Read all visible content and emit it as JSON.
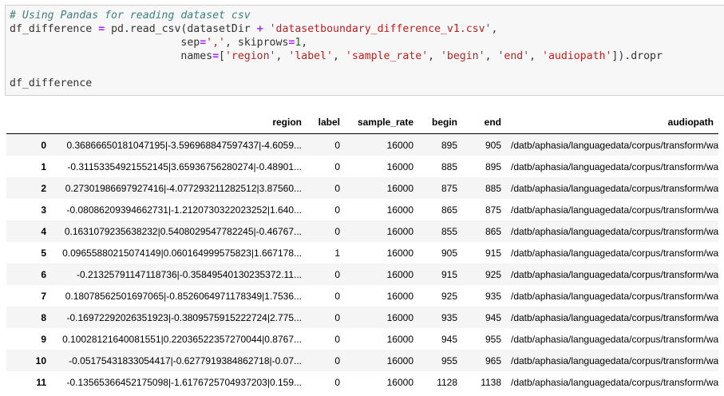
{
  "code_cell": {
    "comment": "# Using Pandas for reading dataset csv",
    "line2": {
      "var": "df_difference",
      "eq": "=",
      "call": "pd.read_csv(datasetDir",
      "plus": "+",
      "file": "'datasetboundary_difference_v1.csv'",
      "comma": ","
    },
    "line3": {
      "indent": "                           ",
      "sep_kw": "sep",
      "eq": "=",
      "sep_val": "','",
      "mid": ", skiprows",
      "eq2": "=",
      "skip_val": "1",
      "end": ","
    },
    "line4": {
      "indent": "                           ",
      "names_kw": "names",
      "eq": "=",
      "open": "[",
      "n1": "'region'",
      "n2": "'label'",
      "n3": "'sample_rate'",
      "n4": "'begin'",
      "n5": "'end'",
      "n6": "'audiopath'",
      "sep": ", ",
      "close": "]).dropr"
    },
    "line6": "df_difference"
  },
  "dataframe": {
    "columns": [
      "region",
      "label",
      "sample_rate",
      "begin",
      "end",
      "audiopath"
    ],
    "rows": [
      {
        "index": "0",
        "region": "0.36866650181047195|-3.596968847597437|-4.6059...",
        "label": "0",
        "sample_rate": "16000",
        "begin": "895",
        "end": "905",
        "audiopath": "/datb/aphasia/languagedata/corpus/transform/wa..."
      },
      {
        "index": "1",
        "region": "-0.31153354921552145|3.65936756280274|-0.48901...",
        "label": "0",
        "sample_rate": "16000",
        "begin": "885",
        "end": "895",
        "audiopath": "/datb/aphasia/languagedata/corpus/transform/wa..."
      },
      {
        "index": "2",
        "region": "0.27301986697927416|-4.077293211282512|3.87560...",
        "label": "0",
        "sample_rate": "16000",
        "begin": "875",
        "end": "885",
        "audiopath": "/datb/aphasia/languagedata/corpus/transform/wa..."
      },
      {
        "index": "3",
        "region": "-0.08086209394662731|-1.2120730322023252|1.640...",
        "label": "0",
        "sample_rate": "16000",
        "begin": "865",
        "end": "875",
        "audiopath": "/datb/aphasia/languagedata/corpus/transform/wa..."
      },
      {
        "index": "4",
        "region": "0.1631079235638232|0.5408029547782245|-0.46767...",
        "label": "0",
        "sample_rate": "16000",
        "begin": "855",
        "end": "865",
        "audiopath": "/datb/aphasia/languagedata/corpus/transform/wa..."
      },
      {
        "index": "5",
        "region": "0.09655880215074149|0.060164999575823|1.667178...",
        "label": "1",
        "sample_rate": "16000",
        "begin": "905",
        "end": "915",
        "audiopath": "/datb/aphasia/languagedata/corpus/transform/wa..."
      },
      {
        "index": "6",
        "region": "-0.21325791147118736|-0.35849540130235372.11...",
        "label": "0",
        "sample_rate": "16000",
        "begin": "915",
        "end": "925",
        "audiopath": "/datb/aphasia/languagedata/corpus/transform/wa..."
      },
      {
        "index": "7",
        "region": "0.18078562501697065|-0.8526064971178349|1.7536...",
        "label": "0",
        "sample_rate": "16000",
        "begin": "925",
        "end": "935",
        "audiopath": "/datb/aphasia/languagedata/corpus/transform/wa..."
      },
      {
        "index": "8",
        "region": "-0.16972292026351923|-0.3809575915222724|2.775...",
        "label": "0",
        "sample_rate": "16000",
        "begin": "935",
        "end": "945",
        "audiopath": "/datb/aphasia/languagedata/corpus/transform/wa..."
      },
      {
        "index": "9",
        "region": "0.10028121640081551|0.22036522357270044|0.8767...",
        "label": "0",
        "sample_rate": "16000",
        "begin": "945",
        "end": "955",
        "audiopath": "/datb/aphasia/languagedata/corpus/transform/wa..."
      },
      {
        "index": "10",
        "region": "-0.05175431833054417|-0.6277919384862718|-0.07...",
        "label": "0",
        "sample_rate": "16000",
        "begin": "955",
        "end": "965",
        "audiopath": "/datb/aphasia/languagedata/corpus/transform/wa..."
      },
      {
        "index": "11",
        "region": "-0.13565366452175098|-1.6176725704937203|0.159...",
        "label": "0",
        "sample_rate": "16000",
        "begin": "1128",
        "end": "1138",
        "audiopath": "/datb/aphasia/languagedata/corpus/transform/wa..."
      }
    ]
  }
}
